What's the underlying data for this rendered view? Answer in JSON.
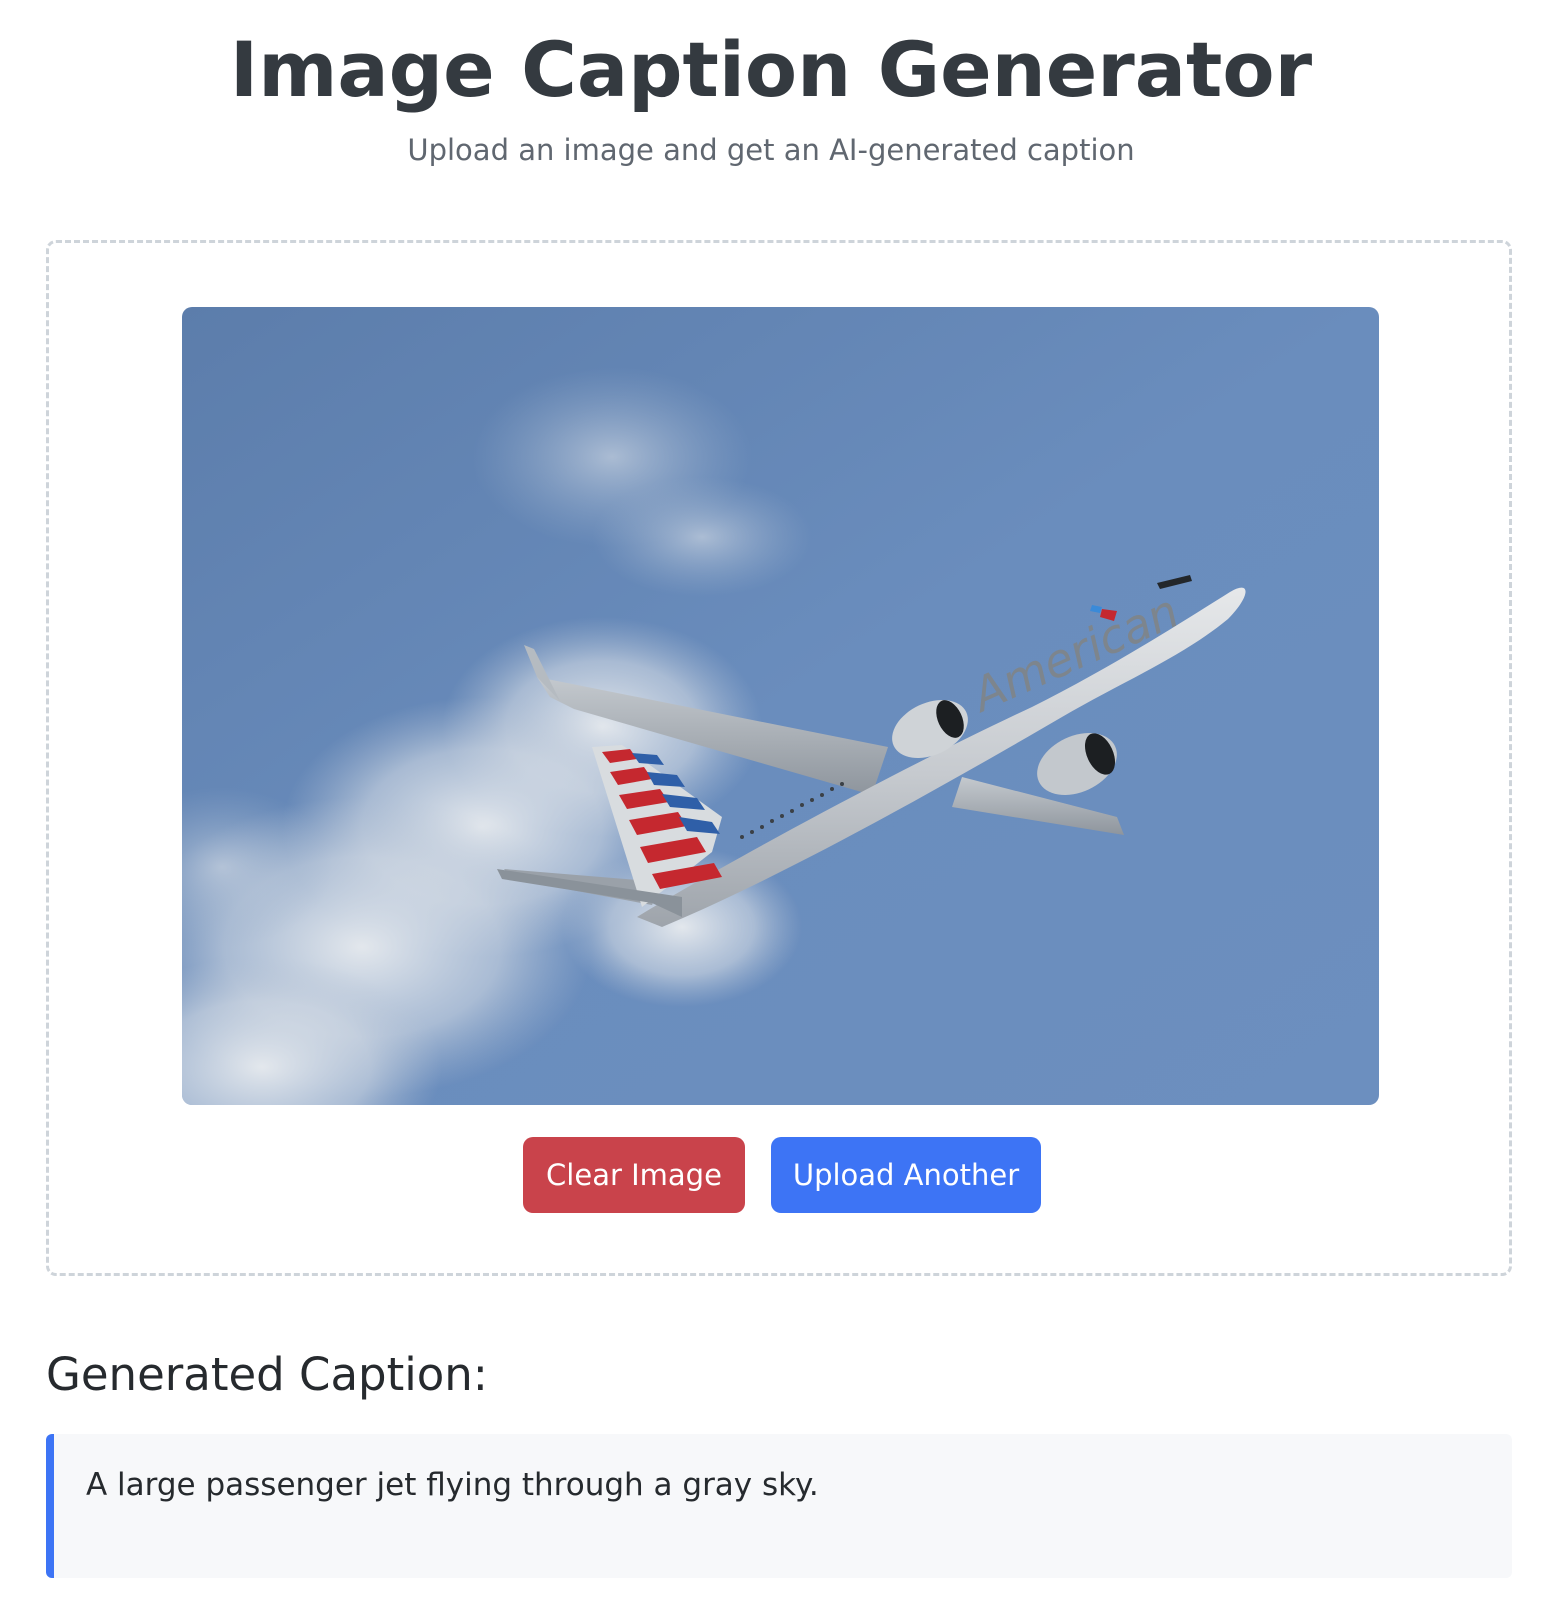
{
  "header": {
    "title": "Image Caption Generator",
    "subtitle": "Upload an image and get an AI-generated caption"
  },
  "upload": {
    "image_alt": "American Airlines passenger jet climbing against a blue sky with white clouds",
    "airline_livery_text": "American",
    "buttons": {
      "clear_label": "Clear Image",
      "upload_another_label": "Upload Another"
    }
  },
  "result": {
    "heading": "Generated Caption:",
    "caption": "A large passenger jet flying through a gray sky."
  },
  "colors": {
    "clear_button": "#c9434b",
    "primary_button": "#3d74f5",
    "caption_accent": "#3d74f5",
    "sky": "#6a8cbc"
  }
}
